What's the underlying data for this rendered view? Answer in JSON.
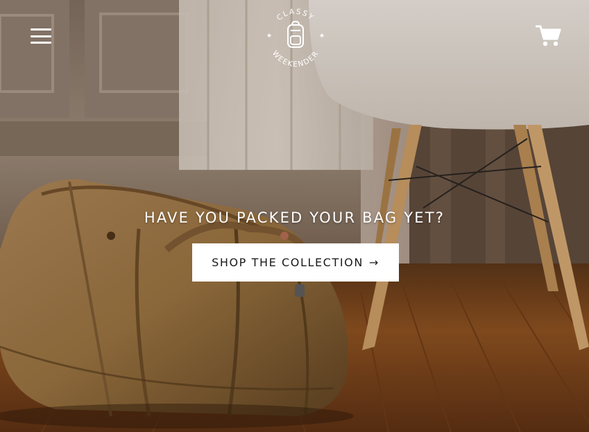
{
  "header": {
    "menu_icon": "hamburger-menu-icon",
    "logo": {
      "top_text": "CLASSY",
      "bottom_text": "WEEKENDER",
      "icon": "backpack-icon"
    },
    "cart_icon": "shopping-cart-icon"
  },
  "hero": {
    "background": "duffel-bag-and-chair-photo",
    "headline": "HAVE YOU PACKED YOUR BAG YET?",
    "cta_label": "SHOP THE COLLECTION",
    "cta_arrow": "→"
  },
  "colors": {
    "text_light": "#ffffff",
    "button_bg": "#ffffff",
    "button_text": "#1a1a1a"
  }
}
